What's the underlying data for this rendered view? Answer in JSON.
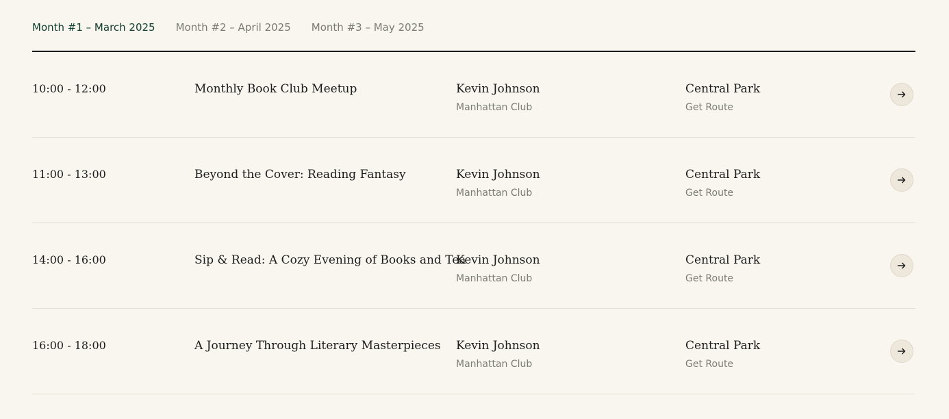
{
  "tabs": [
    {
      "label": "Month #1 – March 2025",
      "active": true
    },
    {
      "label": "Month #2 – April 2025",
      "active": false
    },
    {
      "label": "Month #3 – May 2025",
      "active": false
    }
  ],
  "events": [
    {
      "time": "10:00 - 12:00",
      "title": "Monthly Book Club Meetup",
      "host": "Kevin Johnson",
      "club": "Manhattan Club",
      "location": "Central Park",
      "route_label": "Get Route"
    },
    {
      "time": "11:00 - 13:00",
      "title": "Beyond the Cover: Reading Fantasy",
      "host": "Kevin Johnson",
      "club": "Manhattan Club",
      "location": "Central Park",
      "route_label": "Get Route"
    },
    {
      "time": "14:00 - 16:00",
      "title": "Sip & Read: A Cozy Evening of Books and Tea",
      "host": "Kevin Johnson",
      "club": "Manhattan Club",
      "location": "Central Park",
      "route_label": "Get Route"
    },
    {
      "time": "16:00 - 18:00",
      "title": "A Journey Through Literary Masterpieces",
      "host": "Kevin Johnson",
      "club": "Manhattan Club",
      "location": "Central Park",
      "route_label": "Get Route"
    }
  ],
  "icons": {
    "row_action": "arrow-right-icon"
  },
  "colors": {
    "accent": "#0f3d2e",
    "muted": "#7b7b76",
    "background": "#f9f6ef"
  }
}
